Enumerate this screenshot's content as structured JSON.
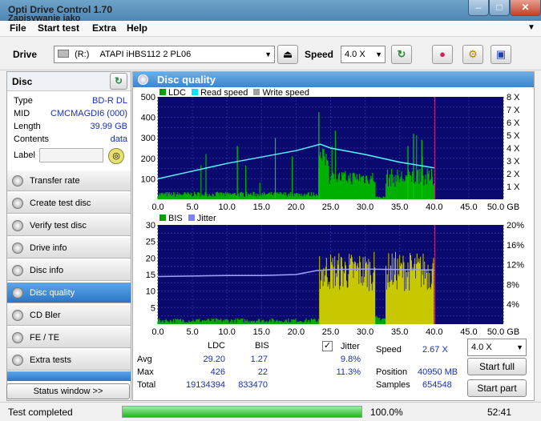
{
  "window": {
    "title": "Opti Drive Control 1.70",
    "subtitle": "Zapisywanie jako"
  },
  "menu": [
    "File",
    "Start test",
    "Extra",
    "Help"
  ],
  "toolbar": {
    "drive_label": "Drive",
    "drive_letter": "(R:)",
    "drive_value": "ATAPI iHBS112  2 PL06",
    "speed_label": "Speed",
    "speed_value": "4.0 X"
  },
  "disc": {
    "title": "Disc",
    "type_label": "Type",
    "type_value": "BD-R DL",
    "mid_label": "MID",
    "mid_value": "CMCMAGDI6 (000)",
    "length_label": "Length",
    "length_value": "39.99 GB",
    "contents_label": "Contents",
    "contents_value": "data",
    "label_label": "Label"
  },
  "nav": [
    "Transfer rate",
    "Create test disc",
    "Verify test disc",
    "Drive info",
    "Disc info",
    "Disc quality",
    "CD Bler",
    "FE / TE",
    "Extra tests"
  ],
  "nav_active": "Disc quality",
  "status_window_button": "Status window >>",
  "panel": {
    "title": "Disc quality"
  },
  "chart_data": [
    {
      "type": "bar",
      "series": [
        {
          "name": "LDC",
          "color": "#00a000"
        },
        {
          "name": "Read speed",
          "color": "#00e5ff"
        },
        {
          "name": "Write speed",
          "color": "#a0a0a0"
        }
      ],
      "xlim": [
        0,
        50
      ],
      "ylim": [
        0,
        500
      ],
      "y2lim": [
        0,
        8
      ],
      "x_ticks": [
        "0.0",
        "5.0",
        "10.0",
        "15.0",
        "20.0",
        "25.0",
        "30.0",
        "35.0",
        "40.0",
        "45.0",
        "50.0 GB"
      ],
      "y_ticks": [
        "100",
        "200",
        "300",
        "400",
        "500"
      ],
      "y2_ticks": [
        "1 X",
        "2 X",
        "3 X",
        "4 X",
        "5 X",
        "6 X",
        "7 X",
        "8 X"
      ],
      "read_speed_x": [
        0,
        5,
        10,
        15,
        20,
        23.5,
        25,
        30,
        35,
        40
      ],
      "read_speed_y": [
        1.6,
        2.2,
        2.8,
        3.3,
        3.8,
        4.3,
        4.0,
        3.5,
        2.9,
        2.45
      ]
    },
    {
      "type": "bar",
      "series": [
        {
          "name": "BIS",
          "color": "#00a000"
        },
        {
          "name": "Jitter",
          "color": "#8080ff"
        }
      ],
      "xlim": [
        0,
        50
      ],
      "ylim": [
        0,
        30
      ],
      "y2lim": [
        0,
        20
      ],
      "x_ticks": [
        "0.0",
        "5.0",
        "10.0",
        "15.0",
        "20.0",
        "25.0",
        "30.0",
        "35.0",
        "40.0",
        "45.0",
        "50.0 GB"
      ],
      "y_ticks": [
        "5",
        "10",
        "15",
        "20",
        "25",
        "30"
      ],
      "y2_ticks": [
        "4%",
        "8%",
        "12%",
        "16%",
        "20%"
      ],
      "jitter_x": [
        0,
        5,
        10,
        15,
        20,
        23,
        25,
        30,
        35,
        40
      ],
      "jitter_y": [
        9.6,
        9.7,
        9.8,
        9.8,
        10.0,
        10.8,
        11.0,
        11.1,
        11.0,
        10.9
      ]
    }
  ],
  "stats": {
    "col_ldc": "LDC",
    "col_bis": "BIS",
    "col_jitter": "Jitter",
    "avg_label": "Avg",
    "max_label": "Max",
    "total_label": "Total",
    "avg_ldc": "29.20",
    "avg_bis": "1.27",
    "avg_jitter": "9.8%",
    "max_ldc": "426",
    "max_bis": "22",
    "max_jitter": "11.3%",
    "total_ldc": "19134394",
    "total_bis": "833470",
    "speed_label": "Speed",
    "speed_value": "2.67 X",
    "position_label": "Position",
    "position_value": "40950 MB",
    "samples_label": "Samples",
    "samples_value": "654548",
    "speed_select": "4.0 X",
    "start_full": "Start full",
    "start_part": "Start part",
    "jitter_checked": true
  },
  "statusbar": {
    "text": "Test completed",
    "progress": 100.0,
    "progress_text": "100.0%",
    "time": "52:41"
  }
}
